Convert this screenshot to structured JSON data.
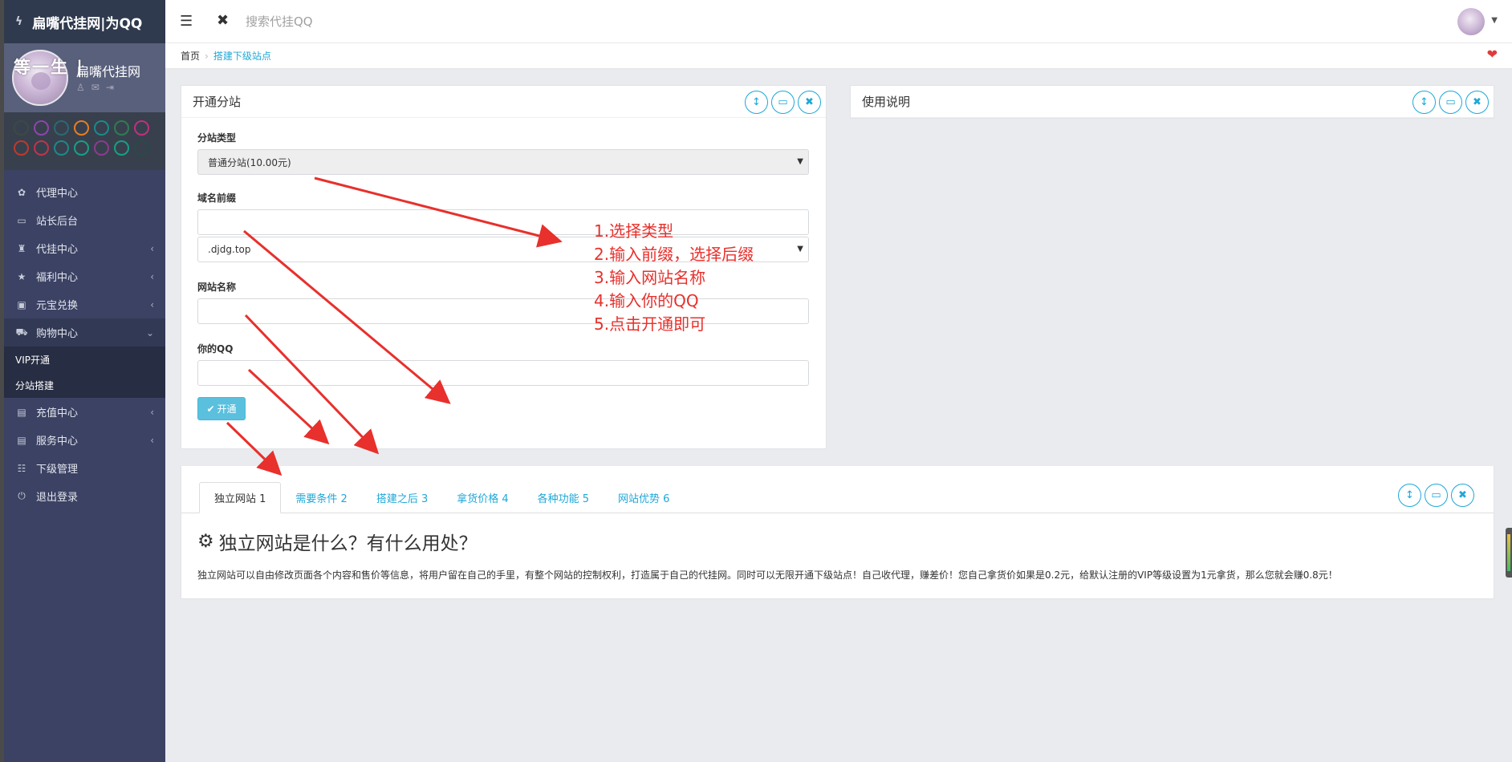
{
  "brand": {
    "title": "扁嘴代挂网|为QQ"
  },
  "profile": {
    "overlay_text": "等一生 |",
    "site_name": "扁嘴代挂网"
  },
  "swatch_colors": [
    [
      "#3b4a45",
      "#8e44ad",
      "#2a6a72",
      "#e67e22",
      "#1a8a8a",
      "#2e7d52",
      "#c0307c"
    ],
    [
      "#c0392b",
      "#c0334d",
      "#1a8a8a",
      "#16a085",
      "#8e3a8e",
      "#16a085",
      "#2a4a4a"
    ]
  ],
  "menu": [
    {
      "icon": "leaf-icon",
      "label": "代理中心",
      "chevron": false
    },
    {
      "icon": "laptop-icon",
      "label": "站长后台",
      "chevron": false
    },
    {
      "icon": "qq-icon",
      "label": "代挂中心",
      "chevron": true
    },
    {
      "icon": "star-icon",
      "label": "福利中心",
      "chevron": true
    },
    {
      "icon": "money-icon",
      "label": "元宝兑换",
      "chevron": true
    },
    {
      "icon": "cart-icon",
      "label": "购物中心",
      "chevron": true,
      "open": true
    },
    {
      "icon": "card-icon",
      "label": "充值中心",
      "chevron": true
    },
    {
      "icon": "file-icon",
      "label": "服务中心",
      "chevron": true
    },
    {
      "icon": "sitemap-icon",
      "label": "下级管理",
      "chevron": false
    },
    {
      "icon": "power-icon",
      "label": "退出登录",
      "chevron": false
    }
  ],
  "submenu": [
    "VIP开通",
    "分站搭建"
  ],
  "header": {
    "search_placeholder": "搜索代挂QQ"
  },
  "breadcrumb": {
    "home": "首页",
    "current": "搭建下级站点"
  },
  "open_panel": {
    "title": "开通分站",
    "type_label": "分站类型",
    "type_value": "普通分站(10.00元)",
    "prefix_label": "域名前缀",
    "suffix_value": ".djdg.top",
    "site_name_label": "网站名称",
    "qq_label": "你的QQ",
    "submit_label": "开通"
  },
  "usage_panel": {
    "title": "使用说明"
  },
  "tabs": [
    {
      "label": "独立网站 1",
      "active": true
    },
    {
      "label": "需要条件 2"
    },
    {
      "label": "搭建之后 3"
    },
    {
      "label": "拿货价格 4"
    },
    {
      "label": "各种功能 5"
    },
    {
      "label": "网站优势 6"
    }
  ],
  "tab_content": {
    "title": "独立网站是什么？有什么用处？",
    "text": "独立网站可以自由修改页面各个内容和售价等信息，将用户留在自己的手里，有整个网站的控制权利，打造属于自己的代挂网。同时可以无限开通下级站点！自己收代理，赚差价！您自己拿货价如果是0.2元，给默认注册的VIP等级设置为1元拿货，那么您就会赚0.8元！"
  },
  "annotations": [
    "1.选择类型",
    "2.输入前缀，选择后缀",
    "3.输入网站名称",
    "4.输入你的QQ",
    "5.点击开通即可"
  ],
  "colors": {
    "sidebar": "#3b4263",
    "accent": "#1fa8d8",
    "annotation": "#e8302c",
    "button": "#5bc0de"
  }
}
